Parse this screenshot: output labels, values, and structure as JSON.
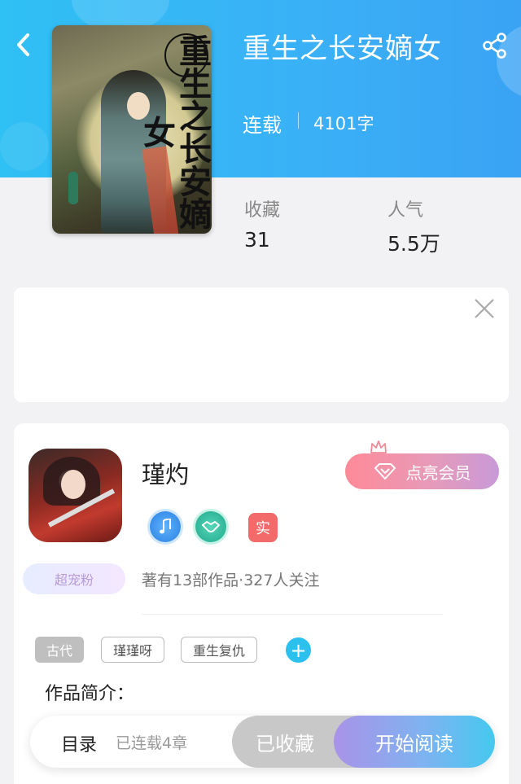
{
  "book": {
    "title": "重生之长安嫡女",
    "cover_text": "重生之长安嫡女",
    "status": "连载",
    "word_count": "4101字"
  },
  "stats": [
    {
      "label": "收藏",
      "value": "31"
    },
    {
      "label": "人气",
      "value": "5.5万"
    }
  ],
  "author": {
    "name": "瑾灼",
    "badge_real": "实",
    "fan_badge": "超宠粉",
    "meta": "著有13部作品·327人关注",
    "vip_button": "点亮会员"
  },
  "tags": [
    "古代",
    "瑾瑾呀",
    "重生复仇"
  ],
  "tag_add": "+",
  "intro_label": "作品简介：",
  "bottom": {
    "toc": "目录",
    "serial": "已连载4章",
    "collected": "已收藏",
    "read": "开始阅读"
  },
  "colors": {
    "header_start": "#2fc0f4",
    "header_end": "#3aa3f4",
    "accent_blue": "#2cc0ee",
    "vip_pink": "#ff8a98"
  },
  "icons": [
    "back-icon",
    "share-icon",
    "close-icon",
    "music-badge-icon",
    "handshake-badge-icon",
    "diamond-icon",
    "crown-icon",
    "add-icon"
  ]
}
